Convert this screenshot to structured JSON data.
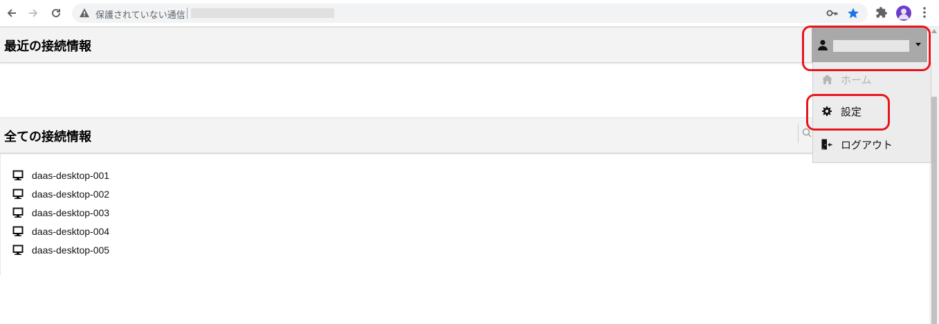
{
  "browser": {
    "security_label": "保護されていない通信",
    "url": ""
  },
  "recent_section": {
    "title": "最近の接続情報"
  },
  "all_section": {
    "title": "全ての接続情報",
    "connections": [
      "daas-desktop-001",
      "daas-desktop-002",
      "daas-desktop-003",
      "daas-desktop-004",
      "daas-desktop-005"
    ]
  },
  "user_menu": {
    "username": "",
    "items": {
      "home": "ホーム",
      "settings": "設定",
      "logout": "ログアウト"
    }
  },
  "colors": {
    "highlight": "#e8141b",
    "user_button_bg": "#a9a9a9",
    "dropdown_bg": "#ececec",
    "header_bg": "#f3f3f3",
    "avatar": "#6a3ec6"
  },
  "icons": {
    "back": "arrow-left-icon",
    "forward": "arrow-right-icon",
    "reload": "reload-icon",
    "security": "warning-triangle-icon",
    "key": "key-icon",
    "bookmark": "star-icon",
    "extensions": "puzzle-icon",
    "menu": "vertical-dots-icon",
    "user": "person-icon",
    "caret": "caret-down-icon",
    "home": "home-icon",
    "settings": "gear-icon",
    "logout": "door-exit-icon",
    "connection": "monitor-icon",
    "search": "search-icon"
  }
}
